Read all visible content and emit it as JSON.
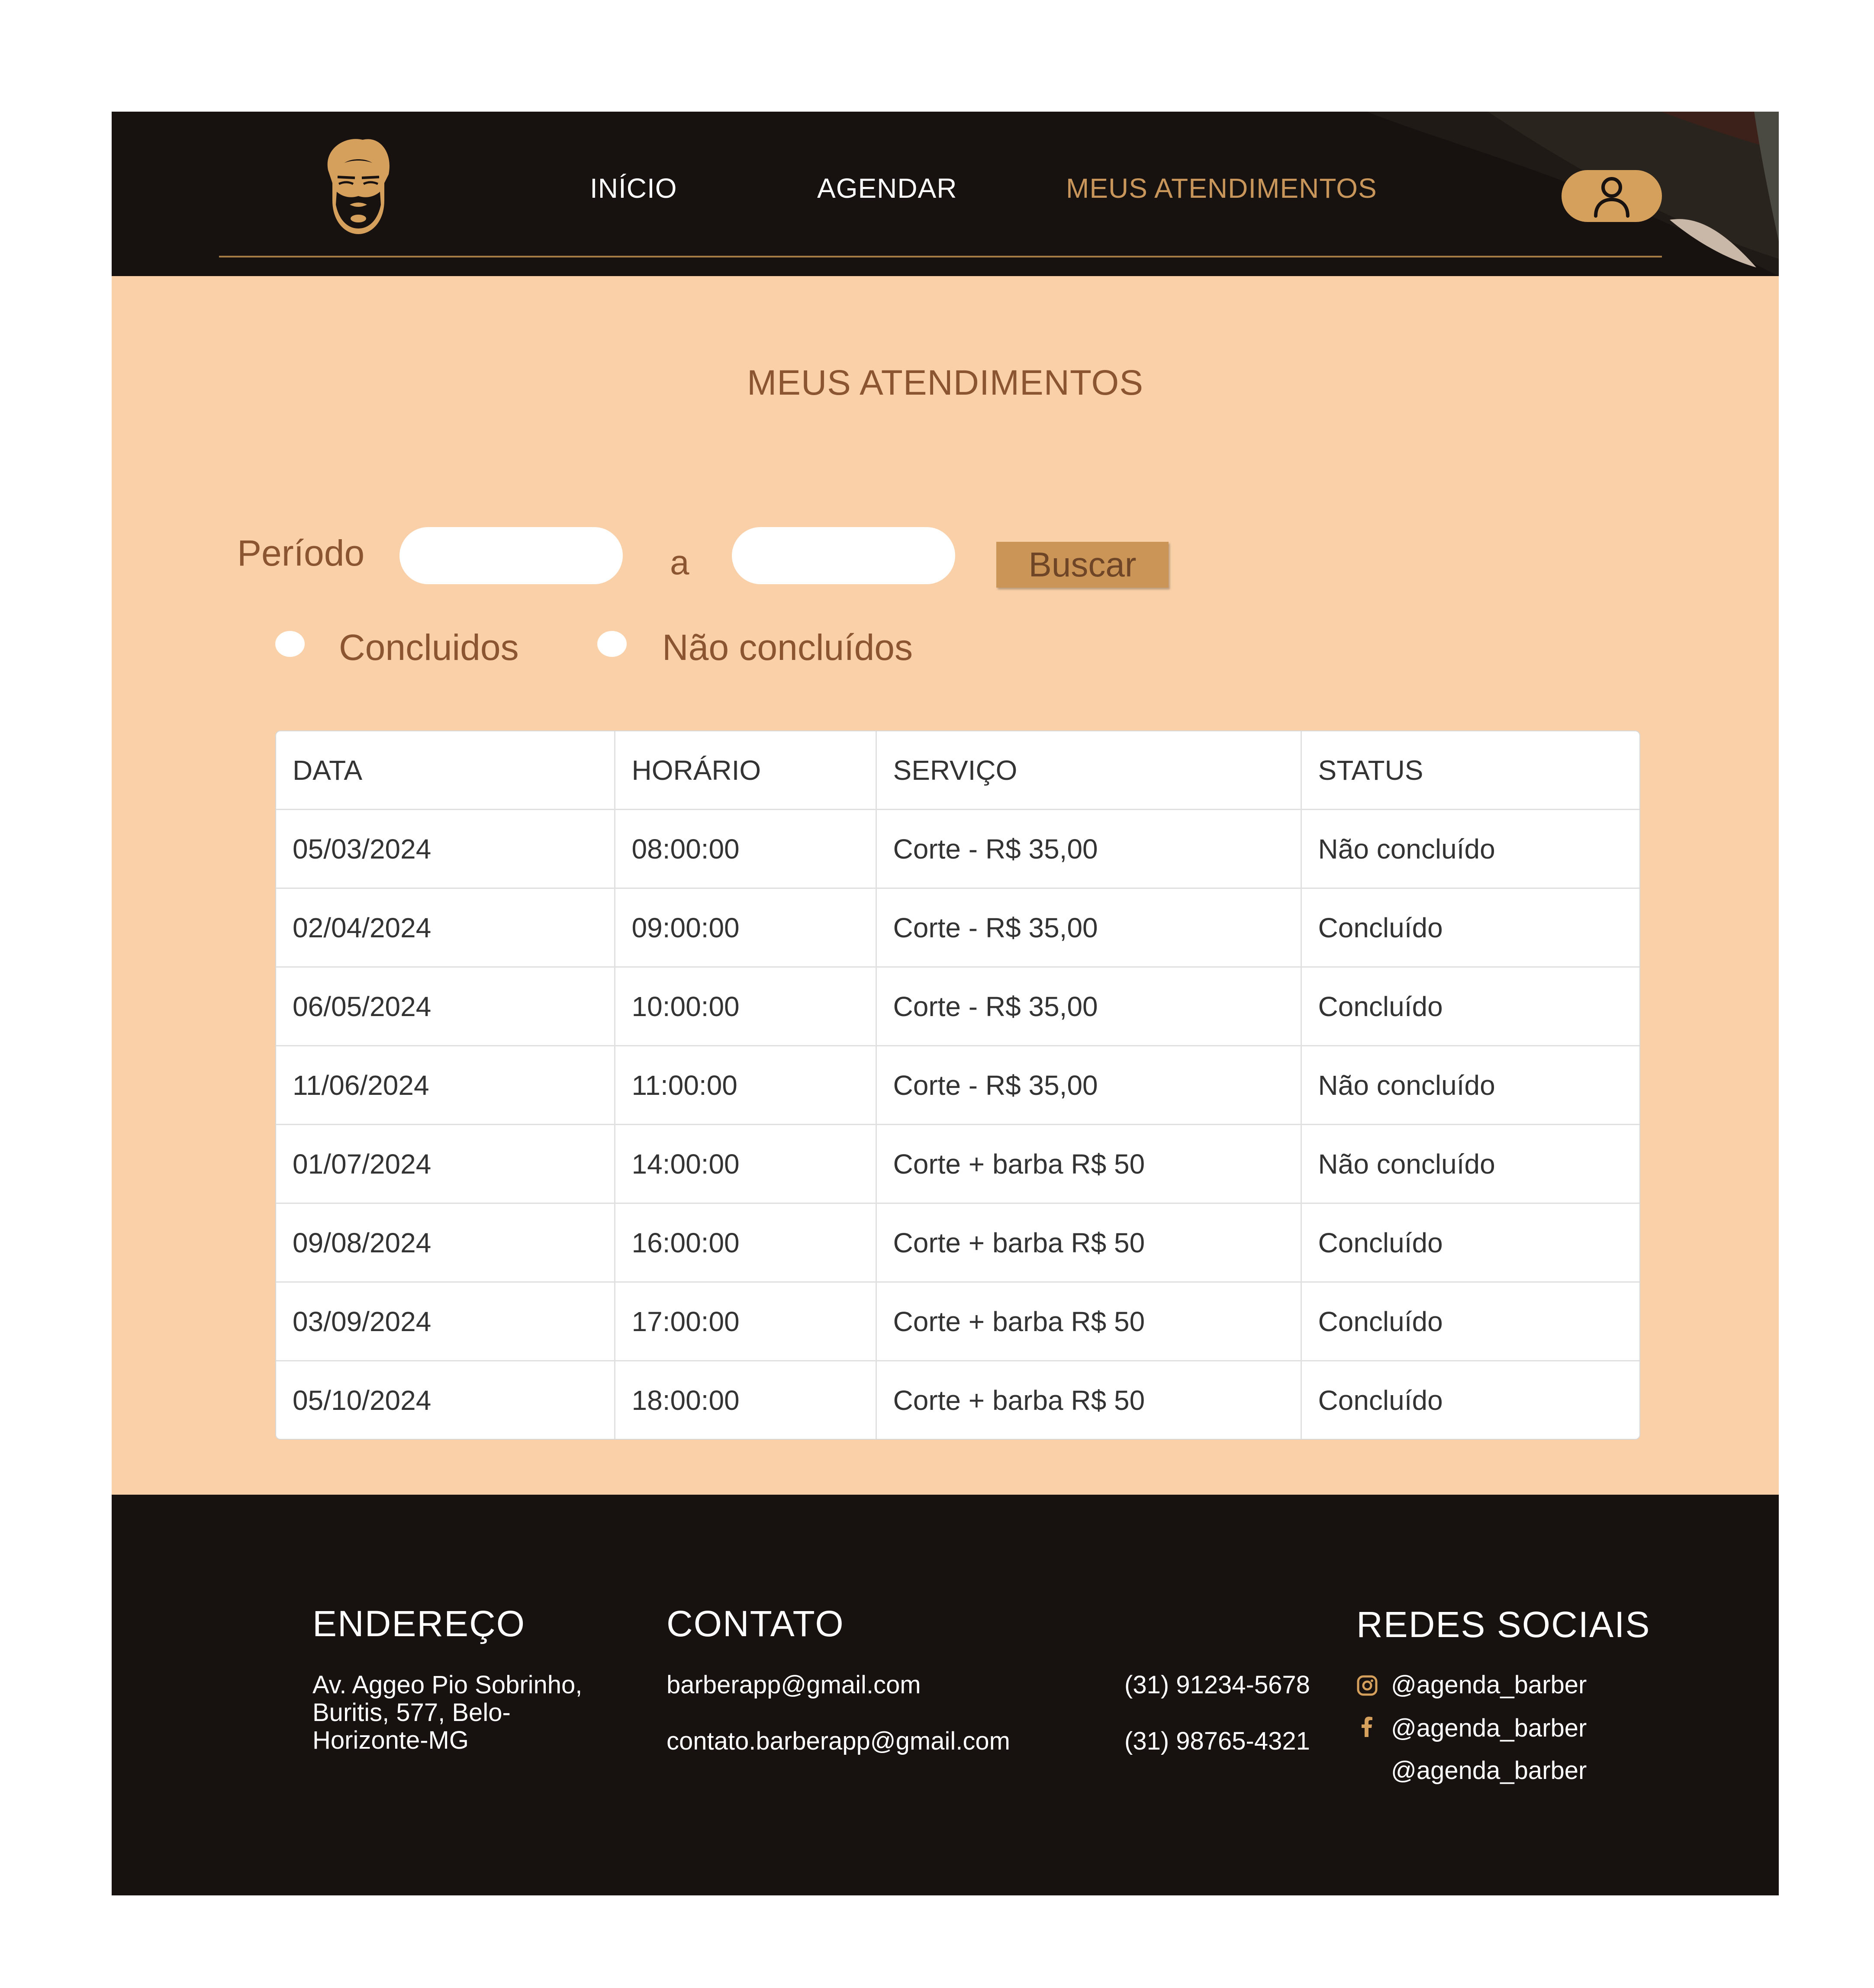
{
  "colors": {
    "header_bg": "#171110",
    "accent": "#c8965a",
    "main_bg": "#f9d0a8",
    "title_text": "#8a5530",
    "button_bg": "#cb9557",
    "footer_bg": "#171110"
  },
  "header": {
    "logo_icon": "bearded-man-icon",
    "nav": [
      {
        "label": "INÍCIO"
      },
      {
        "label": "AGENDAR"
      },
      {
        "label": "MEUS ATENDIMENTOS",
        "active": true
      }
    ],
    "profile_icon": "user-icon"
  },
  "main": {
    "title": "MEUS ATENDIMENTOS",
    "filter": {
      "period_label": "Período",
      "start_value": "",
      "separator": "a",
      "end_value": "",
      "search_button": "Buscar",
      "options": [
        {
          "label": "Concluidos",
          "selected": false
        },
        {
          "label": "Não concluídos",
          "selected": false
        }
      ]
    },
    "table": {
      "headers": [
        "DATA",
        "HORÁRIO",
        "SERVIÇO",
        "STATUS"
      ],
      "rows": [
        [
          "05/03/2024",
          "08:00:00",
          "Corte - R$ 35,00",
          "Não concluído"
        ],
        [
          "02/04/2024",
          "09:00:00",
          "Corte - R$ 35,00",
          "Concluído"
        ],
        [
          "06/05/2024",
          "10:00:00",
          "Corte - R$ 35,00",
          "Concluído"
        ],
        [
          "11/06/2024",
          "11:00:00",
          "Corte - R$ 35,00",
          "Não concluído"
        ],
        [
          "01/07/2024",
          "14:00:00",
          "Corte + barba R$ 50",
          "Não concluído"
        ],
        [
          "09/08/2024",
          "16:00:00",
          "Corte + barba R$ 50",
          "Concluído"
        ],
        [
          "03/09/2024",
          "17:00:00",
          "Corte + barba R$ 50",
          "Concluído"
        ],
        [
          "05/10/2024",
          "18:00:00",
          "Corte + barba R$ 50",
          "Concluído"
        ]
      ]
    }
  },
  "footer": {
    "address": {
      "heading": "ENDEREÇO",
      "text": "Av. Aggeo Pio Sobrinho, Buritis, 577, Belo-Horizonte-MG"
    },
    "contact": {
      "heading": "CONTATO",
      "emails": [
        "barberapp@gmail.com",
        "contato.barberapp@gmail.com"
      ],
      "phones": [
        "(31) 91234-5678",
        "(31) 98765-4321"
      ]
    },
    "social": {
      "heading": "REDES SOCIAIS",
      "items": [
        {
          "icon": "instagram-icon",
          "handle": "@agenda_barber"
        },
        {
          "icon": "facebook-icon",
          "handle": "@agenda_barber"
        },
        {
          "icon": "",
          "handle": "@agenda_barber"
        }
      ]
    }
  }
}
